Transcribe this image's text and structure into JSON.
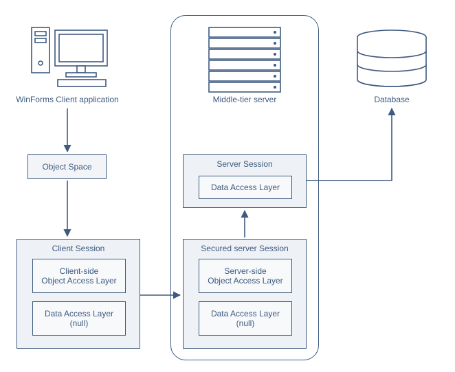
{
  "client": {
    "label": "WinForms Client application",
    "object_space": "Object Space",
    "session": {
      "title": "Client Session",
      "oal": "Client-side\nObject Access Layer",
      "dal": "Data Access Layer\n(null)"
    }
  },
  "server": {
    "label": "Middle-tier server",
    "server_session": {
      "title": "Server Session",
      "dal": "Data Access Layer"
    },
    "secured_session": {
      "title": "Secured server Session",
      "oal": "Server-side\nObject Access Layer",
      "dal": "Data Access Layer\n(null)"
    }
  },
  "db": {
    "label": "Database"
  },
  "colors": {
    "stroke": "#3d5a80",
    "fillLight": "#f2f4f7"
  }
}
